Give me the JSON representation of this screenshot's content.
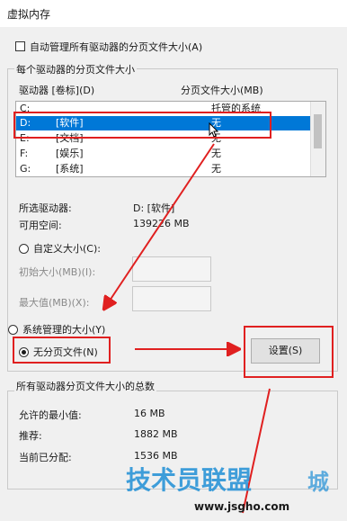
{
  "window": {
    "title": "虚拟内存"
  },
  "auto_manage": {
    "label": "自动管理所有驱动器的分页文件大小(A)",
    "checked": false
  },
  "per_drive": {
    "group_title": "每个驱动器的分页文件大小",
    "col_drive": "驱动器 [卷标](D)",
    "col_size": "分页文件大小(MB)",
    "rows": [
      {
        "drive": "C:",
        "label": "",
        "size": "托管的系统"
      },
      {
        "drive": "D:",
        "label": "[软件]",
        "size": "无"
      },
      {
        "drive": "E:",
        "label": "[文档]",
        "size": "无"
      },
      {
        "drive": "F:",
        "label": "[娱乐]",
        "size": "无"
      },
      {
        "drive": "G:",
        "label": "[系统]",
        "size": "无"
      }
    ],
    "selected_drive_label": "所选驱动器:",
    "selected_drive_value": "D:  [软件]",
    "free_space_label": "可用空间:",
    "free_space_value": "139226 MB",
    "custom_size": "自定义大小(C):",
    "initial_size": "初始大小(MB)(I):",
    "max_size": "最大值(MB)(X):",
    "system_managed": "系统管理的大小(Y)",
    "no_paging": "无分页文件(N)",
    "set_button": "设置(S)"
  },
  "totals": {
    "group_title": "所有驱动器分页文件大小的总数",
    "min_label": "允许的最小值:",
    "min_value": "16 MB",
    "recommended_label": "推荐:",
    "recommended_value": "1882 MB",
    "allocated_label": "当前已分配:",
    "allocated_value": "1536 MB"
  },
  "watermark": {
    "text": "技术员联盟",
    "url": "www.jsgho.com",
    "extra": "城"
  },
  "colors": {
    "selection": "#0078d7",
    "annotation": "#e02020",
    "watermark": "#1f8fd6"
  }
}
